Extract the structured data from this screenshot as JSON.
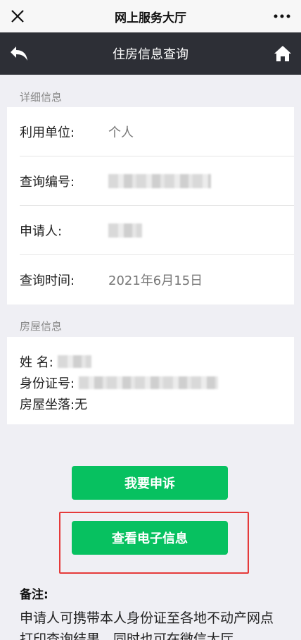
{
  "wechat_bar": {
    "title": "网上服务大厅"
  },
  "header": {
    "title": "住房信息查询"
  },
  "detail_section": {
    "label": "详细信息",
    "rows": [
      {
        "label": "利用单位:",
        "value": "个人"
      },
      {
        "label": "查询编号:",
        "value": ""
      },
      {
        "label": "申请人:",
        "value": ""
      },
      {
        "label": "查询时间:",
        "value": "2021年6月15日"
      }
    ]
  },
  "house_section": {
    "label": "房屋信息",
    "name_label": "姓 名:",
    "id_label": "身份证号:",
    "location_label": "房屋坐落:",
    "location_value": "无"
  },
  "buttons": {
    "appeal": "我要申诉",
    "view_electronic": "查看电子信息"
  },
  "note": {
    "title": "备注:",
    "text": "申请人可携带本人身份证至各地不动产网点打印查询结果，同时也可在微信大厅"
  },
  "colors": {
    "header_bg": "#2d2f36",
    "button_green": "#07c160",
    "highlight_red": "#e53a3a"
  }
}
